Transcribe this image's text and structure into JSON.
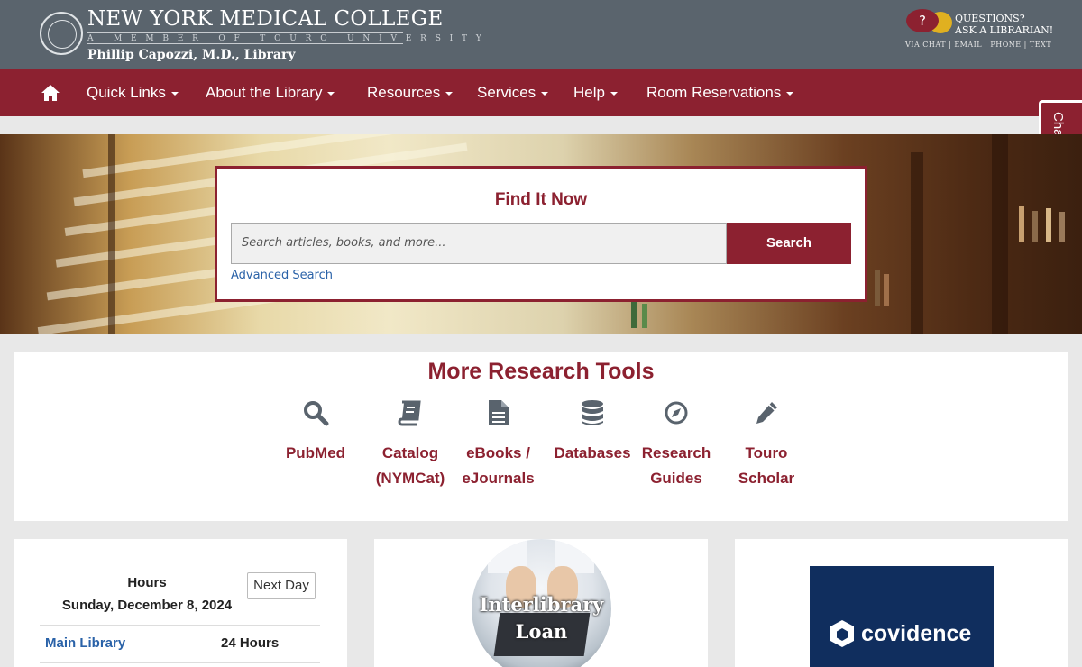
{
  "header": {
    "college_name": "NEW YORK MEDICAL COLLEGE",
    "member_line": "A MEMBER OF TOURO UNIVERSITY",
    "library_name": "Phillip Capozzi, M.D., Library",
    "ask": {
      "bubble": "?",
      "line1": "QUESTIONS?",
      "line2": "ASK A LIBRARIAN!",
      "channels": "VIA CHAT | EMAIL | PHONE | TEXT"
    }
  },
  "nav": {
    "home_icon": "home-icon",
    "items": [
      {
        "label": "Quick Links"
      },
      {
        "label": "About the Library"
      },
      {
        "label": "Resources"
      },
      {
        "label": "Services"
      },
      {
        "label": "Help"
      },
      {
        "label": "Room Reservations"
      }
    ]
  },
  "chat_tab": {
    "label": "Chat with us!"
  },
  "search": {
    "title": "Find It Now",
    "placeholder": "Search articles, books, and more...",
    "button": "Search",
    "advanced": "Advanced Search"
  },
  "tools": {
    "title": "More Research Tools",
    "items": [
      {
        "icon": "search-icon",
        "label": "PubMed"
      },
      {
        "icon": "book-icon",
        "label": "Catalog (NYMCat)"
      },
      {
        "icon": "document-icon",
        "label": "eBooks / eJournals"
      },
      {
        "icon": "database-icon",
        "label": "Databases"
      },
      {
        "icon": "compass-icon",
        "label": "Research Guides"
      },
      {
        "icon": "pencil-icon",
        "label": "Touro Scholar"
      }
    ]
  },
  "hours": {
    "label": "Hours",
    "date": "Sunday, December 8, 2024",
    "next_button": "Next Day",
    "rows": [
      {
        "location": "Main Library",
        "value": "24 Hours"
      }
    ]
  },
  "ill": {
    "text": "Interlibrary Loan"
  },
  "covidence": {
    "text": "covidence"
  },
  "colors": {
    "header_bg": "#5a646d",
    "brand": "#8c2130",
    "link": "#2a62a8",
    "covidence_bg": "#102e5e"
  }
}
